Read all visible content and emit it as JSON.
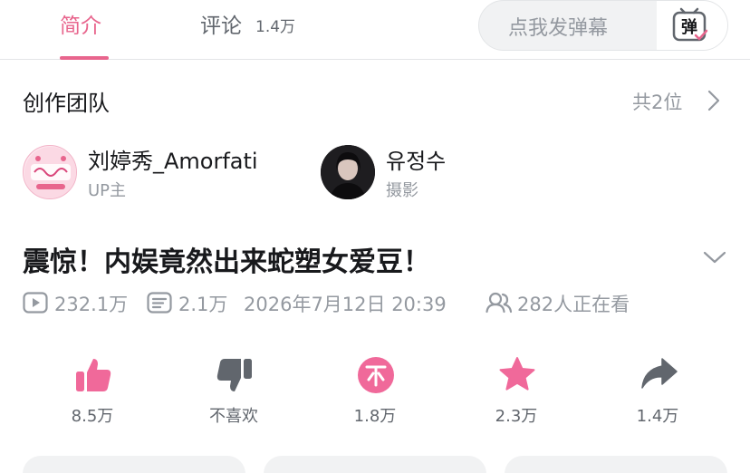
{
  "tabs": {
    "intro_label": "简介",
    "comments_label": "评论",
    "comments_count": "1.4万"
  },
  "danmaku": {
    "placeholder": "点我发弹幕",
    "button_icon": "danmaku-toggle-icon",
    "button_glyph": "弹"
  },
  "team": {
    "title": "创作团队",
    "count_label": "共2位",
    "members": [
      {
        "name": "刘婷秀_Amorfati",
        "role": "UP主",
        "avatar": "avatar-logo-amorfati"
      },
      {
        "name": "유정수",
        "role": "摄影",
        "avatar": "avatar-photo"
      }
    ]
  },
  "video": {
    "title": "震惊！内娱竟然出来蛇塑女爱豆！",
    "views": "232.1万",
    "danmaku_count": "2.1万",
    "publish_time": "2026年7月12日 20:39",
    "watching": "282人正在看"
  },
  "actions": [
    {
      "icon": "thumbs-up-icon",
      "label": "8.5万"
    },
    {
      "icon": "thumbs-down-icon",
      "label": "不喜欢"
    },
    {
      "icon": "coin-icon",
      "label": "1.8万"
    },
    {
      "icon": "star-icon",
      "label": "2.3万"
    },
    {
      "icon": "share-icon",
      "label": "1.4万"
    }
  ],
  "colors": {
    "accent": "#e8658d",
    "action_pink": "#f0699a",
    "action_gray": "#61666d",
    "secondary_text": "#9499a0",
    "primary_text": "#18191c"
  }
}
